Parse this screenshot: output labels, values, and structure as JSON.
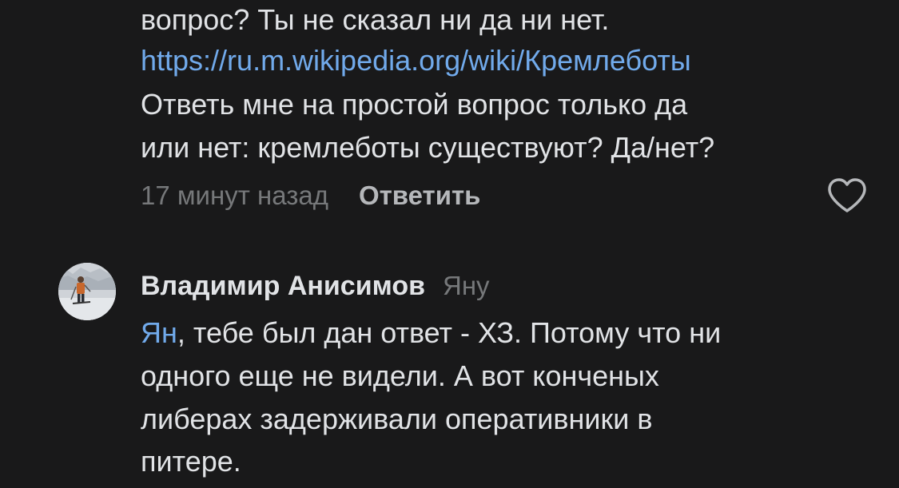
{
  "comment1": {
    "line1": "вопрос? Ты не сказал ни да ни нет.",
    "link": "https://ru.m.wikipedia.org/wiki/Кремлеботы",
    "line3": "Ответь мне на простой вопрос только да",
    "line4": "или нет: кремлеботы существуют? Да/нет?",
    "timestamp": "17 минут назад",
    "reply_label": "Ответить",
    "like_icon": "heart-outline-icon"
  },
  "comment2": {
    "author": "Владимир Анисимов",
    "reply_to": "Яну",
    "mention": "Ян",
    "line1_rest": ", тебе был дан ответ - ХЗ. Потому что ни",
    "line2": "одного еще не видели. А вот конченых",
    "line3": "либерах задерживали оперативники в",
    "line4": "питере.",
    "avatar_icon": "user-avatar-photo"
  },
  "colors": {
    "background": "#19191a",
    "text": "#e1e3e6",
    "link": "#71aaeb",
    "secondary": "#76787a"
  }
}
